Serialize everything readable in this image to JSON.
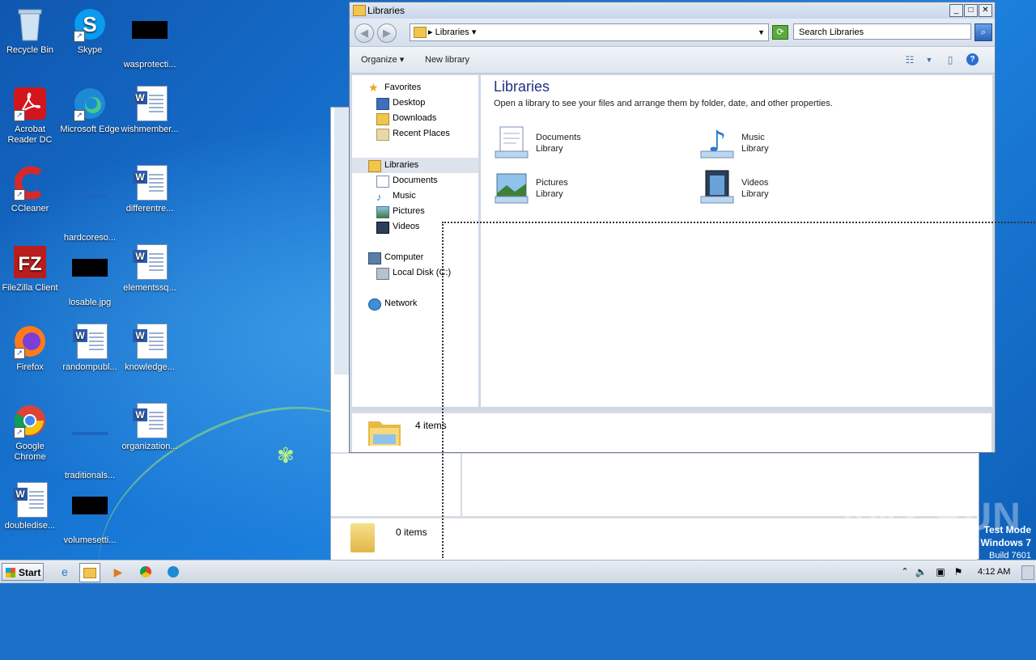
{
  "desktop": {
    "icons": [
      {
        "label": "Recycle Bin",
        "icon": "recycle-bin-icon"
      },
      {
        "label": "Skype",
        "icon": "skype-icon"
      },
      {
        "label": "wasprotecti...",
        "icon": "image-file-icon"
      },
      {
        "label": "Acrobat Reader DC",
        "icon": "acrobat-icon"
      },
      {
        "label": "Microsoft Edge",
        "icon": "edge-icon"
      },
      {
        "label": "wishmember...",
        "icon": "word-document-icon"
      },
      {
        "label": "CCleaner",
        "icon": "ccleaner-icon"
      },
      {
        "label": "hardcoreso...",
        "icon": "file-icon"
      },
      {
        "label": "differentre...",
        "icon": "word-document-icon"
      },
      {
        "label": "FileZilla Client",
        "icon": "filezilla-icon"
      },
      {
        "label": "losable.jpg",
        "icon": "image-file-icon"
      },
      {
        "label": "elementssq...",
        "icon": "word-document-icon"
      },
      {
        "label": "Firefox",
        "icon": "firefox-icon"
      },
      {
        "label": "randompubl...",
        "icon": "word-document-icon"
      },
      {
        "label": "knowledge...",
        "icon": "word-document-icon"
      },
      {
        "label": "Google Chrome",
        "icon": "chrome-icon"
      },
      {
        "label": "traditionals...",
        "icon": "file-icon"
      },
      {
        "label": "organization...",
        "icon": "word-document-icon"
      },
      {
        "label": "doubledise...",
        "icon": "word-document-icon"
      },
      {
        "label": "volumesetti...",
        "icon": "image-file-icon"
      }
    ]
  },
  "window": {
    "title": "Libraries",
    "address": "Libraries",
    "search_placeholder": "Search Libraries",
    "toolbar": {
      "organize": "Organize",
      "new_library": "New library"
    },
    "nav": {
      "favorites": "Favorites",
      "desktop": "Desktop",
      "downloads": "Downloads",
      "recent": "Recent Places",
      "libraries": "Libraries",
      "documents": "Documents",
      "music": "Music",
      "pictures": "Pictures",
      "videos": "Videos",
      "computer": "Computer",
      "local_disk": "Local Disk (C:)",
      "network": "Network"
    },
    "content": {
      "title": "Libraries",
      "subtitle": "Open a library to see your files and arrange them by folder, date, and other properties.",
      "libraries": [
        {
          "name": "Documents",
          "type": "Library"
        },
        {
          "name": "Music",
          "type": "Library"
        },
        {
          "name": "Pictures",
          "type": "Library"
        },
        {
          "name": "Videos",
          "type": "Library"
        }
      ]
    },
    "status": "4 items"
  },
  "back_window": {
    "status": "0 items"
  },
  "taskbar": {
    "start": "Start",
    "clock": "4:12 AM"
  },
  "watermark": "ANY RUN",
  "testmode": {
    "line1": "Test Mode",
    "line2": "Windows 7",
    "line3": "Build 7601"
  },
  "colors": {
    "accent": "#1e3287",
    "selection": "#dde3ec",
    "wallpaper": "#1878d6"
  }
}
